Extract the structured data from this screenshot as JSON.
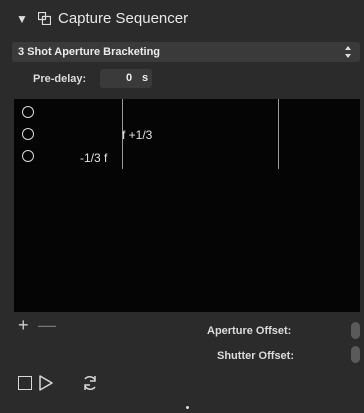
{
  "panel": {
    "title": "Capture Sequencer",
    "expand_icon": "disclosure-triangle-down-icon",
    "title_icon": "capture-sequencer-icon"
  },
  "preset": {
    "selected": "3 Shot Aperture Bracketing",
    "icon": "up-down-arrows-icon"
  },
  "predelay": {
    "label": "Pre-delay:",
    "value": "0",
    "unit": "s"
  },
  "sequence": {
    "shots": [
      {
        "label": ""
      },
      {
        "label": "f +1/3"
      },
      {
        "label": "-1/3 f"
      }
    ]
  },
  "list_controls": {
    "add_label": "+",
    "remove_label": "—"
  },
  "offsets": {
    "aperture_label": "Aperture Offset:",
    "shutter_label": "Shutter Offset:"
  },
  "transport": {
    "stop_icon": "stop-icon",
    "play_icon": "play-icon",
    "loop_icon": "loop-icon"
  }
}
